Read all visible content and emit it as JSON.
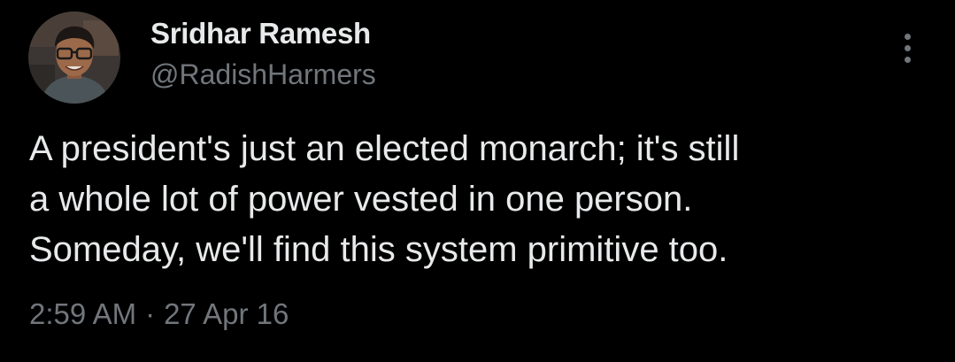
{
  "author": {
    "name": "Sridhar Ramesh",
    "handle": "@RadishHarmers",
    "avatar_icon": "profile-photo"
  },
  "menu": {
    "icon": "more-vertical-icon"
  },
  "tweet": {
    "lines": [
      "A president's just an elected monarch; it's still",
      "a whole lot of power vested in one person.",
      "Someday, we'll find this system primitive too."
    ],
    "time": "2:59 AM",
    "separator": "·",
    "date": "27 Apr 16"
  },
  "colors": {
    "background": "#000000",
    "primary_text": "#e7e9ea",
    "secondary_text": "#71767b"
  }
}
